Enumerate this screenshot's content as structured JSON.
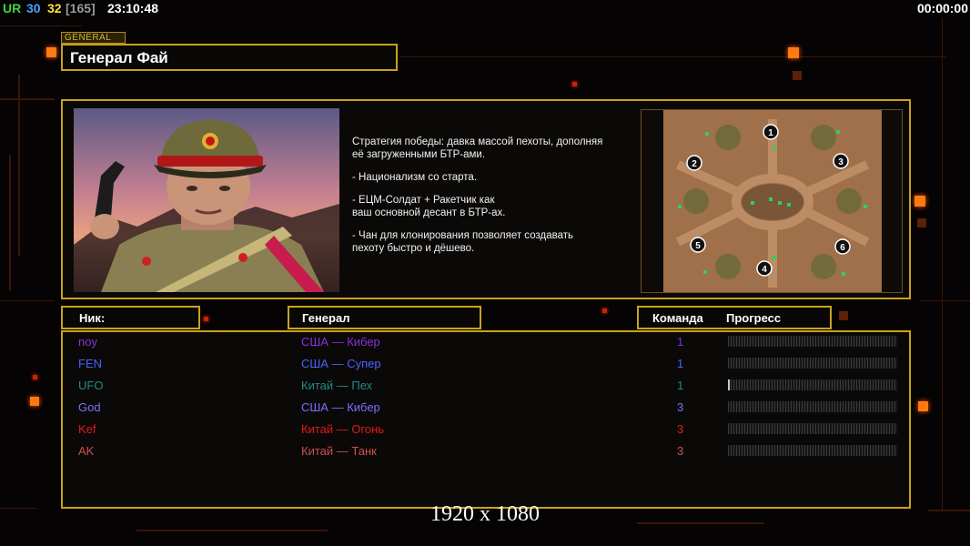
{
  "status_bar": {
    "ur_label": "UR",
    "num_blue": "30",
    "num_yellow": "32",
    "num_gray": "[165]",
    "clock": "23:10:48",
    "timer": "00:00:00"
  },
  "general": {
    "tag": "GENERAL",
    "name": "Генерал Фай",
    "description": [
      "Стратегия победы: давка массой пехоты, дополняя\n её загруженными БТР-ами.",
      "- Национализм со старта.",
      "- ЕЦМ-Солдат + Ракетчик как\nваш основной десант в БТР-ах.",
      "- Чан для клонирования позволяет создавать\n пехоту быстро и дёшево."
    ]
  },
  "map": {
    "start_positions": [
      "1",
      "2",
      "3",
      "4",
      "5",
      "6"
    ]
  },
  "headers": {
    "nick": "Ник:",
    "general": "Генерал",
    "team": "Команда",
    "progress": "Прогресс"
  },
  "players": [
    {
      "nick": "noy",
      "general": "США — Кибер",
      "team": "1",
      "color": "#8a2ee0",
      "progress": 0.0
    },
    {
      "nick": "FEN",
      "general": "США — Супер",
      "team": "1",
      "color": "#4a62ff",
      "progress": 0.0
    },
    {
      "nick": "UFO",
      "general": "Китай — Пех",
      "team": "1",
      "color": "#1f8c8c",
      "progress": 0.01
    },
    {
      "nick": "God",
      "general": "США — Кибер",
      "team": "3",
      "color": "#7a70ff",
      "progress": 0.0
    },
    {
      "nick": "Kef",
      "general": "Китай — Огонь",
      "team": "3",
      "color": "#e01a1a",
      "progress": 0.0
    },
    {
      "nick": "AK",
      "general": "Китай — Танк",
      "team": "3",
      "color": "#d05050",
      "progress": 0.0
    }
  ],
  "resolution_label": "1920 x 1080",
  "colors": {
    "frame": "#c9a21d",
    "accent": "#ff7a10"
  }
}
